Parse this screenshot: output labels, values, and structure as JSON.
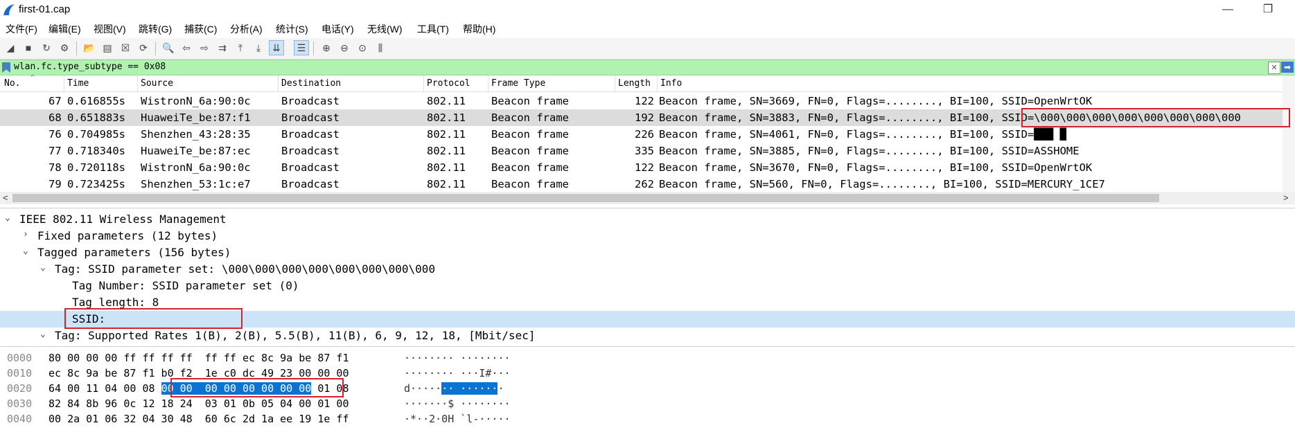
{
  "window": {
    "title": "first-01.cap",
    "minimize": "—",
    "restore": "❐"
  },
  "menu": [
    "文件(F)",
    "编辑(E)",
    "视图(V)",
    "跳转(G)",
    "捕获(C)",
    "分析(A)",
    "统计(S)",
    "电话(Y)",
    "无线(W)",
    "工具(T)",
    "帮助(H)"
  ],
  "filter": {
    "value": "wlan.fc.type_subtype == 0x08",
    "clear": "✕",
    "apply": "➡"
  },
  "packet_list": {
    "columns": [
      "No.",
      "Time",
      "Source",
      "Destination",
      "Protocol",
      "Frame Type",
      "Length",
      "Info"
    ],
    "rows": [
      {
        "no": "67",
        "time": "0.616855s",
        "src": "WistronN_6a:90:0c",
        "dst": "Broadcast",
        "proto": "802.11",
        "ftype": "Beacon frame",
        "len": "122",
        "info": "Beacon frame, SN=3669, FN=0, Flags=........, BI=100, SSID=OpenWrtOK"
      },
      {
        "no": "68",
        "time": "0.651883s",
        "src": "HuaweiTe_be:87:f1",
        "dst": "Broadcast",
        "proto": "802.11",
        "ftype": "Beacon frame",
        "len": "192",
        "info": "Beacon frame, SN=3883, FN=0, Flags=........, BI=100, SSID=\\000\\000\\000\\000\\000\\000\\000\\000"
      },
      {
        "no": "76",
        "time": "0.704985s",
        "src": "Shenzhen_43:28:35",
        "dst": "Broadcast",
        "proto": "802.11",
        "ftype": "Beacon frame",
        "len": "226",
        "info": "Beacon frame, SN=4061, FN=0, Flags=........, BI=100, SSID=███ █"
      },
      {
        "no": "77",
        "time": "0.718340s",
        "src": "HuaweiTe_be:87:ec",
        "dst": "Broadcast",
        "proto": "802.11",
        "ftype": "Beacon frame",
        "len": "335",
        "info": "Beacon frame, SN=3885, FN=0, Flags=........, BI=100, SSID=ASSHOME"
      },
      {
        "no": "78",
        "time": "0.720118s",
        "src": "WistronN_6a:90:0c",
        "dst": "Broadcast",
        "proto": "802.11",
        "ftype": "Beacon frame",
        "len": "122",
        "info": "Beacon frame, SN=3670, FN=0, Flags=........, BI=100, SSID=OpenWrtOK"
      },
      {
        "no": "79",
        "time": "0.723425s",
        "src": "Shenzhen_53:1c:e7",
        "dst": "Broadcast",
        "proto": "802.11",
        "ftype": "Beacon frame",
        "len": "262",
        "info": "Beacon frame, SN=560, FN=0, Flags=........, BI=100, SSID=MERCURY_1CE7"
      }
    ],
    "selected_no": "68"
  },
  "details": [
    "IEEE 802.11 Wireless Management",
    "Fixed parameters (12 bytes)",
    "Tagged parameters (156 bytes)",
    "Tag: SSID parameter set: \\000\\000\\000\\000\\000\\000\\000\\000",
    "Tag Number: SSID parameter set (0)",
    "Tag length: 8",
    "SSID: ",
    "Tag: Supported Rates 1(B), 2(B), 5.5(B), 11(B), 6, 9, 12, 18, [Mbit/sec]"
  ],
  "bytes": [
    {
      "offset": "0000",
      "hex": "80 00 00 00 ff ff ff ff  ff ff ec 8c 9a be 87 f1",
      "ascii": "········ ········"
    },
    {
      "offset": "0010",
      "hex": "ec 8c 9a be 87 f1 b0 f2  1e c0 dc 49 23 00 00 00",
      "ascii": "········ ···I#···"
    },
    {
      "offset": "0020",
      "hex_pre": "64 00 11 04 00 08 ",
      "hex_hl": "00 00  00 00 00 00 00 00",
      "hex_post": " 01 08",
      "ascii_pre": "d·····",
      "ascii_hl": "·· ······",
      "ascii_post": "·"
    },
    {
      "offset": "0030",
      "hex": "82 84 8b 96 0c 12 18 24  03 01 0b 05 04 00 01 00",
      "ascii": "·······$ ········"
    },
    {
      "offset": "0040",
      "hex": "00 2a 01 06 32 04 30 48  60 6c 2d 1a ee 19 1e ff",
      "ascii": "·*··2·0H `l-·····"
    }
  ]
}
